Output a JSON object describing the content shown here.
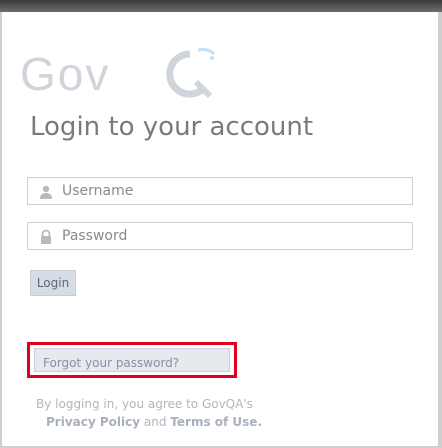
{
  "brand": {
    "logo_text": "GovQA",
    "logo_visible_letters": "Gov"
  },
  "form": {
    "title": "Login to your account",
    "username": {
      "placeholder": "Username",
      "value": "",
      "icon": "user-icon"
    },
    "password": {
      "placeholder": "Password",
      "value": "",
      "icon": "lock-icon"
    },
    "login_label": "Login",
    "forgot_label": "Forgot your password?"
  },
  "legal": {
    "prefix": "By logging in, you agree to GovQA's",
    "privacy_label": "Privacy Policy",
    "and": "and",
    "terms_label": "Terms of Use."
  },
  "colors": {
    "highlight_border": "#e0001b",
    "logo": "#d0d5db",
    "link": "#8592a5"
  }
}
